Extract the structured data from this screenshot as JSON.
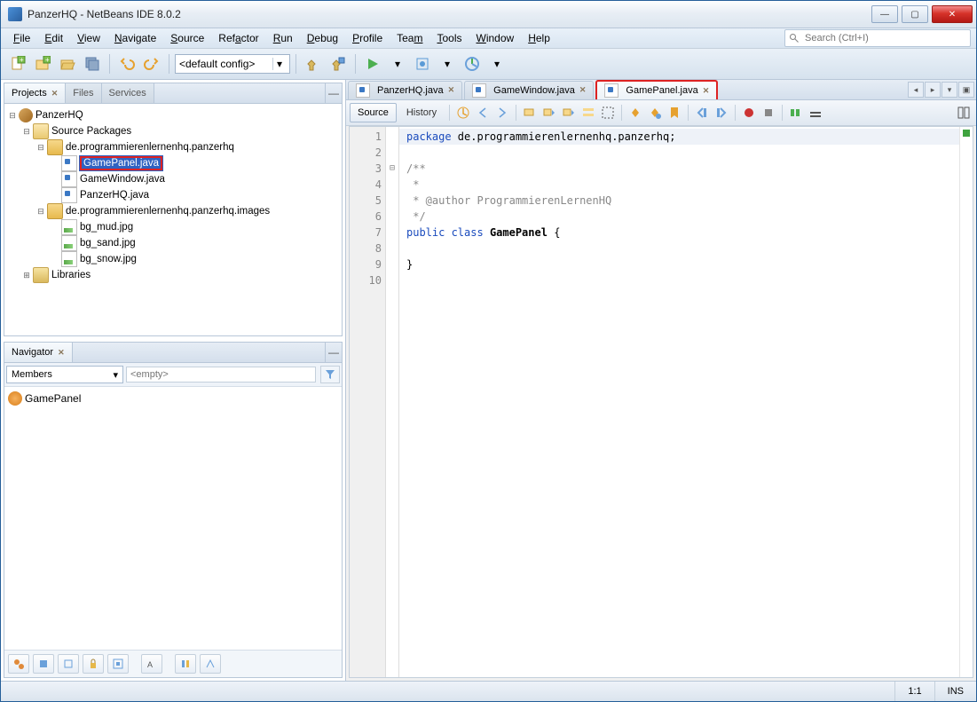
{
  "title": "PanzerHQ - NetBeans IDE 8.0.2",
  "menu": [
    "File",
    "Edit",
    "View",
    "Navigate",
    "Source",
    "Refactor",
    "Run",
    "Debug",
    "Profile",
    "Team",
    "Tools",
    "Window",
    "Help"
  ],
  "search_placeholder": "Search (Ctrl+I)",
  "config_label": "<default config>",
  "left_tabs": {
    "projects": "Projects",
    "files": "Files",
    "services": "Services"
  },
  "tree": {
    "root": "PanzerHQ",
    "src": "Source Packages",
    "pkg1": "de.programmierenlernenhq.panzerhq",
    "f1": "GamePanel.java",
    "f2": "GameWindow.java",
    "f3": "PanzerHQ.java",
    "pkg2": "de.programmierenlernenhq.panzerhq.images",
    "i1": "bg_mud.jpg",
    "i2": "bg_sand.jpg",
    "i3": "bg_snow.jpg",
    "libs": "Libraries"
  },
  "navigator": {
    "title": "Navigator",
    "members": "Members",
    "empty": "<empty>",
    "class": "GamePanel"
  },
  "editor_tabs": {
    "t1": "PanzerHQ.java",
    "t2": "GameWindow.java",
    "t3": "GamePanel.java"
  },
  "ed_toggle": {
    "source": "Source",
    "history": "History"
  },
  "code": {
    "l1_kw": "package",
    "l1_rest": " de.programmierenlernenhq.panzerhq;",
    "l3": "/**",
    "l4": " *",
    "l5": " * @author ProgrammierenLernenHQ",
    "l6": " */",
    "l7_kw1": "public ",
    "l7_kw2": "class ",
    "l7_b": "GamePanel",
    "l7_r": " {",
    "l9": "}"
  },
  "status": {
    "pos": "1:1",
    "ins": "INS"
  }
}
